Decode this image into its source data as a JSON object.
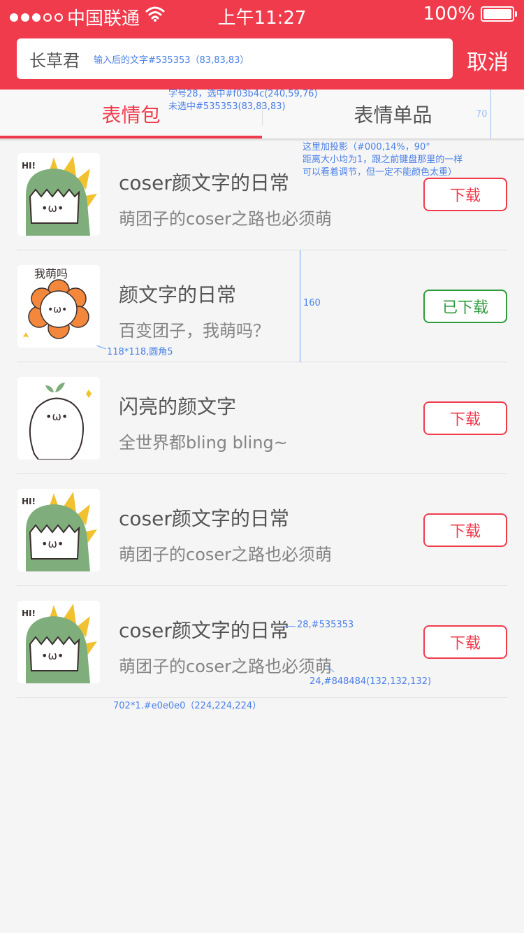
{
  "status_bar": {
    "carrier": "中国联通",
    "time": "上午11:27",
    "battery": "100%"
  },
  "search": {
    "query": "长草君",
    "note": "输入后的文字#535353（83,83,83）",
    "cancel": "取消"
  },
  "tabs": [
    {
      "label": "表情包",
      "selected": true
    },
    {
      "label": "表情单品",
      "selected": false
    }
  ],
  "annotations": {
    "tab_font": "字号28，选中#f03b4c(240,59,76)",
    "tab_unselected": "未选中#535353(83,83,83)",
    "tab_height": "70",
    "shadow_1": "这里加投影（#000,14%，90°",
    "shadow_2": "距离大小均为1，跟之前键盘那里的一样",
    "shadow_3": "可以看着调节，但一定不能颜色太重）",
    "row_height": "160",
    "thumb_size": "118*118,圆角5",
    "title_font": "28,#535353",
    "subtitle_font": "24,#848484(132,132,132)",
    "divider": "702*1.#e0e0e0（224,224,224）"
  },
  "items": [
    {
      "title": "coser颜文字的日常",
      "subtitle": "萌团子的coser之路也必须萌",
      "button": "下载",
      "downloaded": false,
      "thumb": "dino"
    },
    {
      "title": "颜文字的日常",
      "subtitle": "百变团子，我萌吗？",
      "button": "已下载",
      "downloaded": true,
      "thumb": "flower",
      "thumb_text": "我萌吗"
    },
    {
      "title": "闪亮的颜文字",
      "subtitle": "全世界都bling bling~",
      "button": "下载",
      "downloaded": false,
      "thumb": "sprout"
    },
    {
      "title": "coser颜文字的日常",
      "subtitle": "萌团子的coser之路也必须萌",
      "button": "下载",
      "downloaded": false,
      "thumb": "dino"
    },
    {
      "title": "coser颜文字的日常",
      "subtitle": "萌团子的coser之路也必须萌",
      "button": "下载",
      "downloaded": false,
      "thumb": "dino"
    }
  ],
  "colors": {
    "brand": "#f03b4c",
    "text": "#535353",
    "subtext": "#848484",
    "divider": "#e0e0e0",
    "downloaded": "#2f9b3a"
  }
}
